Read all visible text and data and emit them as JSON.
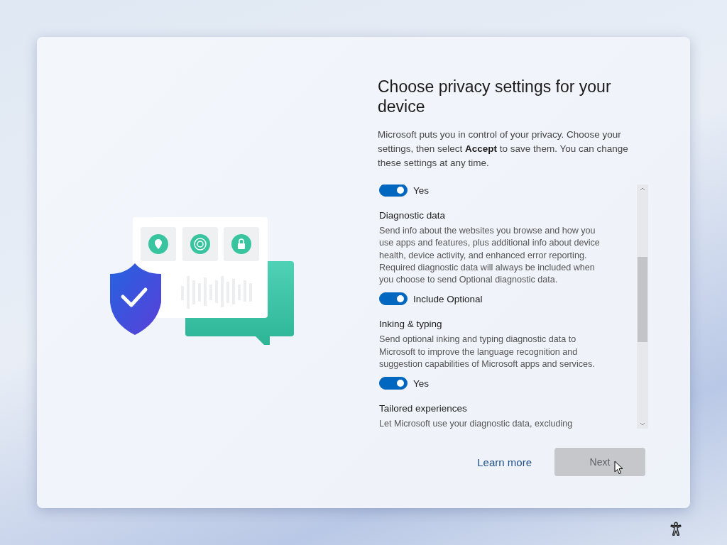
{
  "heading": "Choose privacy settings for your device",
  "intro": "Microsoft puts you in control of your privacy. Choose your settings, then select **Accept** to save them. You can change these settings at any time.",
  "settings": [
    {
      "toggle": {
        "on": true,
        "label": "Yes"
      }
    },
    {
      "title": "Diagnostic data",
      "description": "Send info about the websites you browse and how you use apps and features, plus additional info about device health, device activity, and enhanced error reporting. Required diagnostic data will always be included when you choose to send Optional diagnostic data.",
      "toggle": {
        "on": true,
        "label": "Include Optional"
      }
    },
    {
      "title": "Inking & typing",
      "description": "Send optional inking and typing diagnostic data to Microsoft to improve the language recognition and suggestion capabilities of Microsoft apps and services.",
      "toggle": {
        "on": true,
        "label": "Yes"
      }
    },
    {
      "title": "Tailored experiences",
      "description": "Let Microsoft use your diagnostic data, excluding"
    }
  ],
  "learn_more": "Learn more",
  "next_button": {
    "label": "Next",
    "disabled": true
  }
}
